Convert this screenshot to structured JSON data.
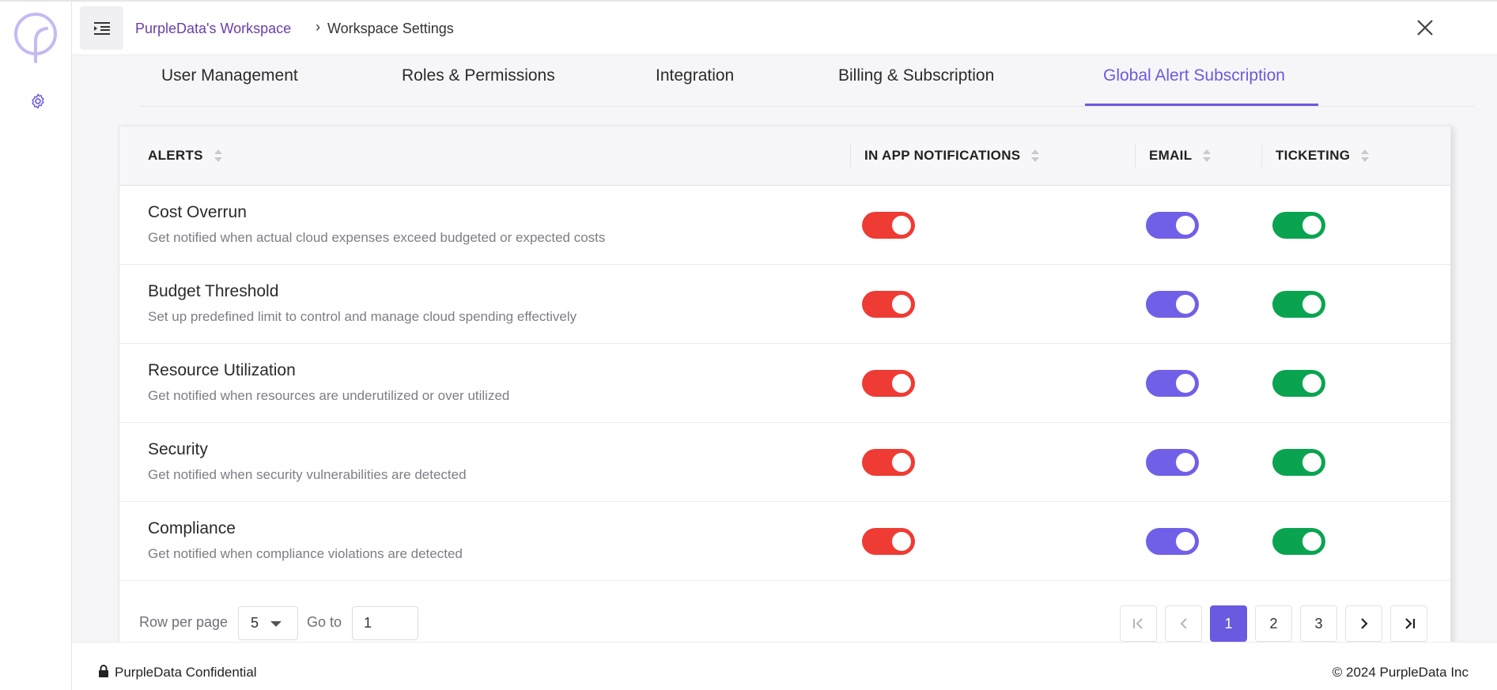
{
  "header": {
    "workspace": "PurpleData's Workspace",
    "separator": "›",
    "page": "Workspace Settings"
  },
  "tabs": [
    {
      "label": "User Management",
      "active": false
    },
    {
      "label": "Roles & Permissions",
      "active": false
    },
    {
      "label": "Integration",
      "active": false
    },
    {
      "label": "Billing & Subscription",
      "active": false
    },
    {
      "label": "Global Alert Subscription",
      "active": true
    }
  ],
  "table": {
    "columns": [
      "ALERTS",
      "IN APP NOTIFICATIONS",
      "EMAIL",
      "TICKETING"
    ],
    "rows": [
      {
        "title": "Cost Overrun",
        "desc": "Get notified when actual cloud expenses exceed budgeted or expected costs",
        "in_app": true,
        "email": true,
        "ticketing": true
      },
      {
        "title": "Budget Threshold",
        "desc": "Set up predefined limit to control and manage cloud spending effectively",
        "in_app": true,
        "email": true,
        "ticketing": true
      },
      {
        "title": "Resource Utilization",
        "desc": "Get notified when resources are underutilized or over utilized",
        "in_app": true,
        "email": true,
        "ticketing": true
      },
      {
        "title": "Security",
        "desc": "Get notified when security vulnerabilities are detected",
        "in_app": true,
        "email": true,
        "ticketing": true
      },
      {
        "title": "Compliance",
        "desc": "Get notified when compliance violations are detected",
        "in_app": true,
        "email": true,
        "ticketing": true
      }
    ]
  },
  "pagination": {
    "rows_label": "Row per page",
    "rows_value": "5",
    "goto_label": "Go to",
    "goto_value": "1",
    "pages": [
      "1",
      "2",
      "3"
    ],
    "current_page": "1"
  },
  "footer": {
    "confidential": "PurpleData Confidential",
    "copyright": "© 2024 PurpleData Inc"
  },
  "colors": {
    "accent": "#6a5ae0",
    "in_app_toggle": "#ee3b34",
    "email_toggle": "#7060e8",
    "ticketing_toggle": "#0aa451"
  },
  "icons": {
    "logo": "purpledata-logo",
    "settings": "gear-icon",
    "menu": "menu-toggle-icon",
    "close": "close-icon",
    "lock": "lock-icon"
  }
}
